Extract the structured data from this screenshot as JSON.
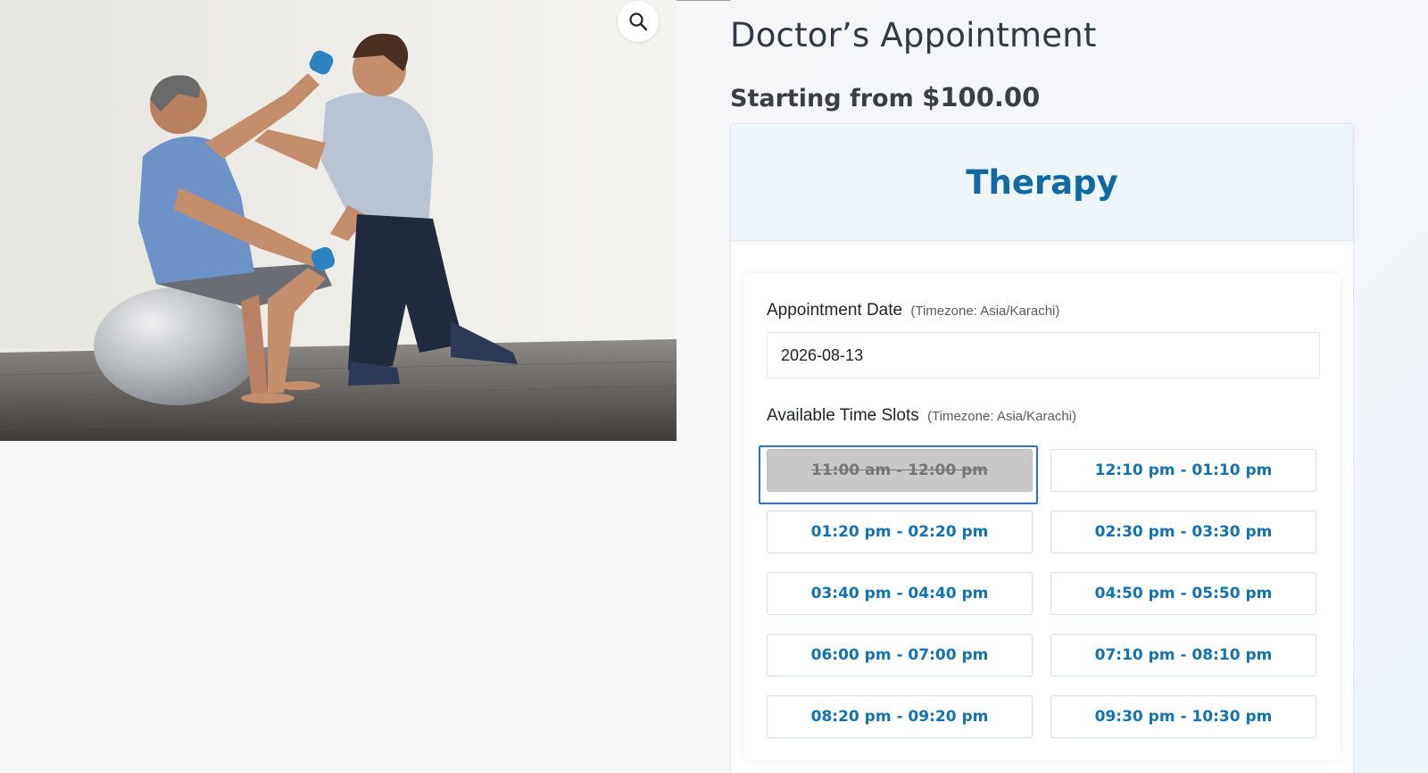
{
  "product": {
    "title": "Doctor’s Appointment",
    "price_prefix": "Starting from",
    "price": "$100.00"
  },
  "gallery": {
    "zoom_icon": "search-icon"
  },
  "booking": {
    "service_name": "Therapy",
    "date_label": "Appointment Date",
    "date_timezone": "(Timezone: Asia/Karachi)",
    "date_value": "2026-08-13",
    "slots_label": "Available Time Slots",
    "slots_timezone": "(Timezone: Asia/Karachi)",
    "slots": [
      {
        "label": "11:00 am - 12:00 pm",
        "available": false
      },
      {
        "label": "12:10 pm - 01:10 pm",
        "available": true
      },
      {
        "label": "01:20 pm - 02:20 pm",
        "available": true
      },
      {
        "label": "02:30 pm - 03:30 pm",
        "available": true
      },
      {
        "label": "03:40 pm - 04:40 pm",
        "available": true
      },
      {
        "label": "04:50 pm - 05:50 pm",
        "available": true
      },
      {
        "label": "06:00 pm - 07:00 pm",
        "available": true
      },
      {
        "label": "07:10 pm - 08:10 pm",
        "available": true
      },
      {
        "label": "08:20 pm - 09:20 pm",
        "available": true
      },
      {
        "label": "09:30 pm - 10:30 pm",
        "available": true
      }
    ]
  },
  "colors": {
    "accent": "#1273b0",
    "header_bg": "#eef5fd",
    "booked_bg": "#c8c8c8",
    "focus_ring": "#2f6fd1"
  }
}
